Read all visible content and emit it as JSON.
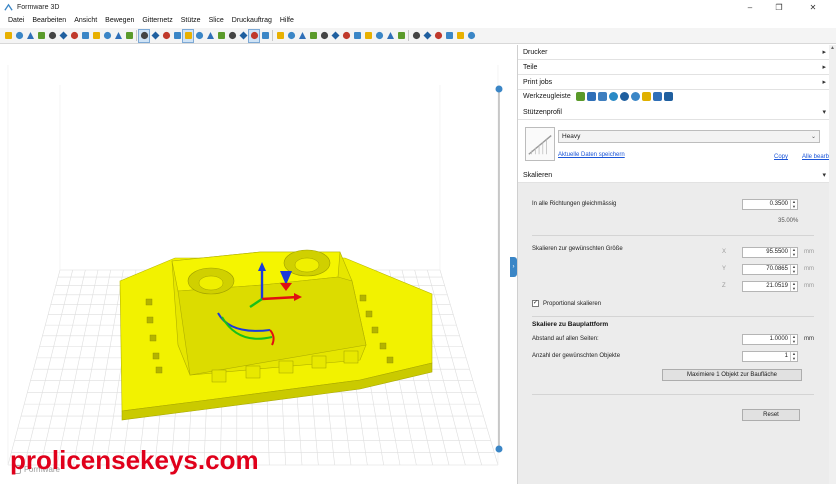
{
  "window": {
    "title": "Formware 3D",
    "controls": [
      "–",
      "❐",
      "✕"
    ]
  },
  "menu": [
    "Datei",
    "Bearbeiten",
    "Ansicht",
    "Bewegen",
    "Gitternetz",
    "Stütze",
    "Slice",
    "Druckauftrag",
    "Hilfe"
  ],
  "toolbar": {
    "icons": [
      "new-file-icon",
      "open-folder-icon",
      "open-model-icon",
      "import-icon",
      "save-icon",
      "save-as-icon",
      "printer-icon",
      "settings-gear-icon",
      "support-icon",
      "place-icon",
      "undo-icon",
      "redo-icon",
      "view-iso-icon",
      "view-top-icon",
      "view-front-icon",
      "view-side-icon",
      "view-cube-icon",
      "view-sphere-icon",
      "ortho-icon",
      "perspective-icon",
      "wire-icon",
      "solid-icon",
      "select-icon",
      "measure-icon",
      "grid-icon",
      "layer-icon",
      "scale-icon",
      "rotate-icon",
      "move-icon",
      "mirror-icon",
      "arrange-icon",
      "duplicate-icon",
      "cut-icon",
      "hollow-icon",
      "drain-icon",
      "label-icon",
      "repair-icon",
      "slice-icon",
      "preview-icon",
      "send-icon",
      "export-icon",
      "help-icon"
    ]
  },
  "viewport": {
    "watermark": "prolicensekeys.com",
    "brand": "Formware"
  },
  "panel": {
    "sections": {
      "drucker": "Drucker",
      "teile": "Teile",
      "print_jobs": "Print jobs",
      "werkzeugleiste": "Werkzeugleiste",
      "stuetzenprofil": "Stützenprofil",
      "skalieren": "Skalieren"
    },
    "profile": {
      "selected": "Heavy",
      "link_update": "Aktuelle Daten speichern",
      "link_copy": "Copy",
      "link_all": "Alle bearb"
    },
    "scale": {
      "uniform_label": "In alle Richtungen gleichmässig",
      "uniform_value": "0.3500",
      "uniform_percent": "35.00%",
      "size_label": "Skalieren zur gewünschten Größe",
      "x_label": "X",
      "x_value": "95.5500",
      "y_label": "Y",
      "y_value": "70.0865",
      "z_label": "Z",
      "z_value": "21.0519",
      "unit": "mm",
      "proportional_label": "Proportional skalieren",
      "proportional_checked": true,
      "platform_heading": "Skaliere zu Bauplattform",
      "distance_label": "Abstand auf allen Seiten:",
      "distance_value": "1.0000",
      "count_label": "Anzahl der gewünschten Objekte",
      "count_value": "1",
      "maximize_button": "Maximiere 1 Objekt zur Baufläche",
      "reset_button": "Reset"
    }
  },
  "colors": {
    "model": "#f2f200",
    "model_shade": "#c9c900",
    "accent": "#3b86c6",
    "watermark": "#e0001b"
  }
}
